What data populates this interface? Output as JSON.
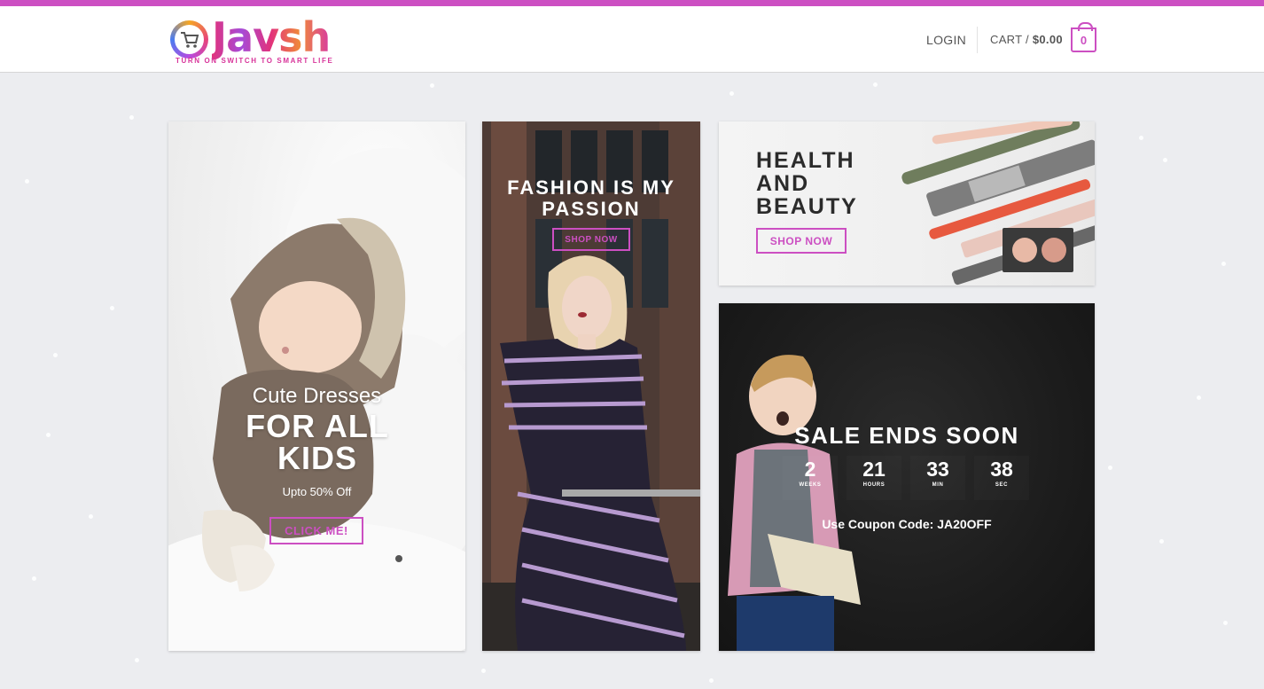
{
  "header": {
    "logo_word": "Javsh",
    "logo_tagline": "TURN ON SWITCH TO SMART LIFE",
    "login_label": "LOGIN",
    "cart_label": "CART /",
    "cart_total": "$0.00",
    "cart_count": "0"
  },
  "colors": {
    "accent": "#cc4fc2",
    "background": "#ecedf0"
  },
  "panels": {
    "kids": {
      "title_small": "Cute Dresses",
      "title_large": "FOR ALL KIDS",
      "subtitle": "Upto 50% Off",
      "button_label": "CLICK ME!"
    },
    "fashion": {
      "title": "FASHION IS MY PASSION",
      "button_label": "SHOP NOW"
    },
    "health": {
      "title": "HEALTH AND BEAUTY",
      "button_label": "SHOP NOW"
    },
    "sale": {
      "title": "SALE ENDS SOON",
      "countdown": [
        {
          "value": "2",
          "label": "WEEKS"
        },
        {
          "value": "21",
          "label": "HOURS"
        },
        {
          "value": "33",
          "label": "MIN"
        },
        {
          "value": "38",
          "label": "SEC"
        }
      ],
      "coupon": "Use Coupon Code: JA20OFF"
    }
  },
  "icons": {
    "logo_icon": "shopping-cart-icon",
    "cart_icon": "bag-icon"
  }
}
